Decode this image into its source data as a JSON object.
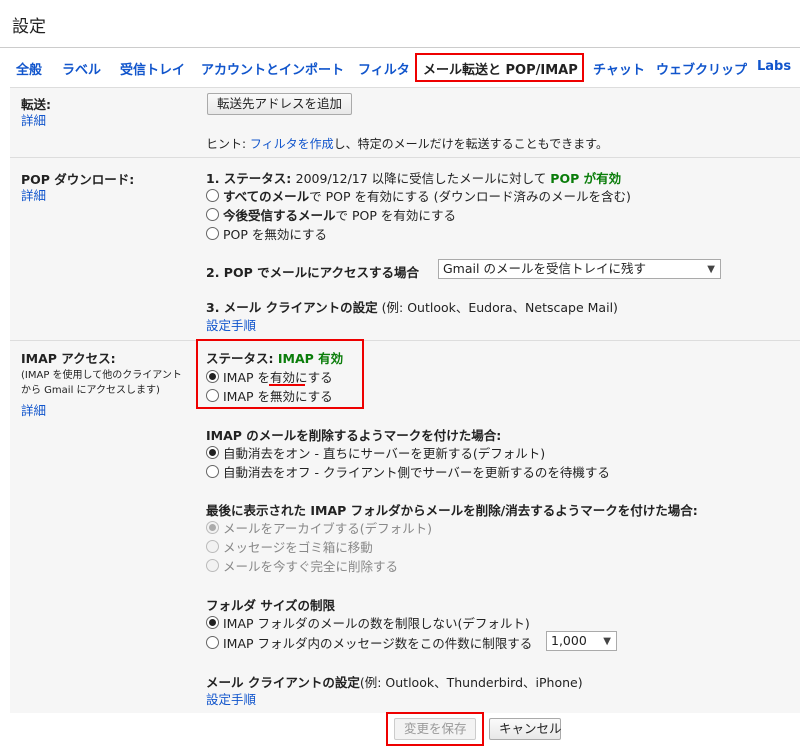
{
  "page": {
    "title": "設定"
  },
  "tabs": [
    {
      "label": "全般"
    },
    {
      "label": "ラベル"
    },
    {
      "label": "受信トレイ"
    },
    {
      "label": "アカウントとインポート"
    },
    {
      "label": "フィルタ"
    },
    {
      "label": "メール転送と POP/IMAP",
      "active": true
    },
    {
      "label": "チャット"
    },
    {
      "label": "ウェブクリップ"
    },
    {
      "label": "Labs"
    }
  ],
  "forwarding": {
    "label": "転送:",
    "detail_link": "詳細",
    "add_button": "転送先アドレスを追加",
    "hint_prefix": "ヒント: ",
    "hint_link": "フィルタを作成",
    "hint_suffix": "し、特定のメールだけを転送することもできます。"
  },
  "pop": {
    "label": "POP ダウンロード:",
    "detail_link": "詳細",
    "status_prefix": "1. ステータス: ",
    "status_text": "2009/12/17 以降に受信したメールに対して ",
    "status_value": "POP が有効",
    "options": [
      {
        "bold": "すべてのメール",
        "text": "で POP を有効にする (ダウンロード済みのメールを含む)",
        "checked": false
      },
      {
        "bold": "今後受信するメール",
        "text": "で POP を有効にする",
        "checked": false
      },
      {
        "bold": "",
        "text": "POP を無効にする",
        "checked": false
      }
    ],
    "access_label": "2. POP でメールにアクセスする場合",
    "access_value": "Gmail のメールを受信トレイに残す",
    "client_label_bold": "3. メール クライアントの設定",
    "client_label_rest": " (例: Outlook、Eudora、Netscape Mail)",
    "setup_link": "設定手順"
  },
  "imap": {
    "label": "IMAP アクセス:",
    "sub": "(IMAP を使用して他のクライアントから Gmail にアクセスします)",
    "detail_link": "詳細",
    "status_prefix": "ステータス: ",
    "status_value": "IMAP 有効",
    "enable_option": "IMAP を有効にする",
    "disable_option": "IMAP を無効にする",
    "delete_heading": "IMAP のメールを削除するようマークを付けた場合:",
    "delete_options": [
      {
        "text": "自動消去をオン - 直ちにサーバーを更新する(デフォルト)",
        "checked": true
      },
      {
        "text": "自動消去をオフ - クライアント側でサーバーを更新するのを待機する",
        "checked": false
      }
    ],
    "expunge_heading": "最後に表示された IMAP フォルダからメールを削除/消去するようマークを付けた場合:",
    "expunge_options": [
      {
        "text": "メールをアーカイブする(デフォルト)",
        "checked": true
      },
      {
        "text": "メッセージをゴミ箱に移動",
        "checked": false
      },
      {
        "text": "メールを今すぐ完全に削除する",
        "checked": false
      }
    ],
    "folder_heading": "フォルダ サイズの制限",
    "folder_options": [
      {
        "text": "IMAP フォルダのメールの数を制限しない(デフォルト)",
        "checked": true
      },
      {
        "text": "IMAP フォルダ内のメッセージ数をこの件数に制限する",
        "checked": false
      }
    ],
    "folder_limit_value": "1,000",
    "client_label_bold": "メール クライアントの設定",
    "client_label_rest": "(例: Outlook、Thunderbird、iPhone)",
    "setup_link": "設定手順"
  },
  "footer": {
    "save_button": "変更を保存",
    "cancel_button": "キャンセル"
  },
  "colors": {
    "link": "#1155cc",
    "status_green": "#0a7d0a",
    "highlight_red": "#ee0000"
  }
}
